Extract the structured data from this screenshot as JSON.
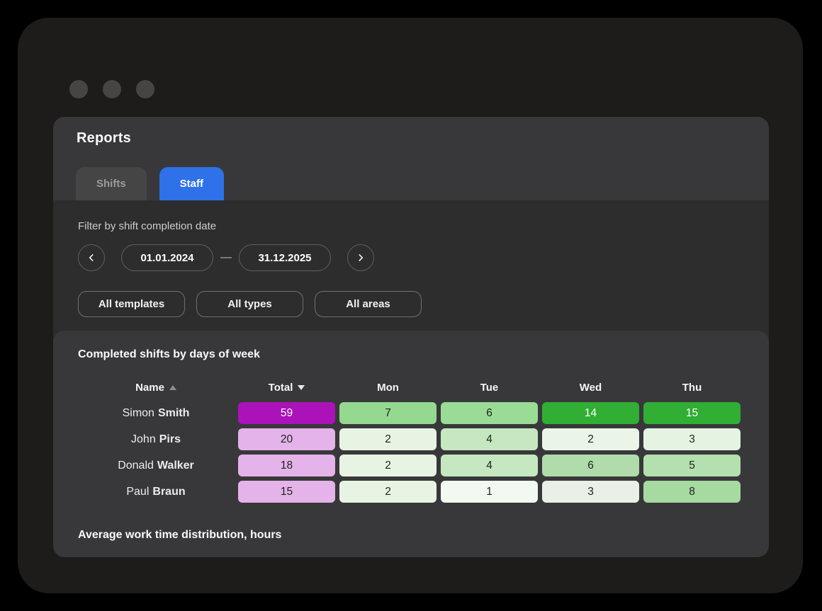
{
  "header": {
    "title": "Reports",
    "tabs": [
      {
        "label": "Shifts",
        "active": false
      },
      {
        "label": "Staff",
        "active": true
      }
    ]
  },
  "filters": {
    "label": "Filter by shift completion date",
    "date_from": "01.01.2024",
    "date_separator": "—",
    "date_to": "31.12.2025",
    "template_filter": "All templates",
    "type_filter": "All types",
    "area_filter": "All areas"
  },
  "table": {
    "title": "Completed shifts by days of week",
    "columns": [
      {
        "label": "Name",
        "sort": "asc"
      },
      {
        "label": "Total",
        "sort": "desc"
      },
      {
        "label": "Mon"
      },
      {
        "label": "Tue"
      },
      {
        "label": "Wed"
      },
      {
        "label": "Thu"
      }
    ],
    "rows": [
      {
        "first_name": "Simon",
        "last_name": "Smith",
        "cells": [
          {
            "value": "59",
            "bg": "#ab12b9",
            "fg": "#ffffff"
          },
          {
            "value": "7",
            "bg": "#95d890",
            "fg": "#1f2020"
          },
          {
            "value": "6",
            "bg": "#9adb95",
            "fg": "#1f2020"
          },
          {
            "value": "14",
            "bg": "#31ae34",
            "fg": "#ffffff"
          },
          {
            "value": "15",
            "bg": "#31ae34",
            "fg": "#ffffff"
          }
        ]
      },
      {
        "first_name": "John",
        "last_name": "Pirs",
        "cells": [
          {
            "value": "20",
            "bg": "#e4b3e9",
            "fg": "#1f2020"
          },
          {
            "value": "2",
            "bg": "#e7f4e4",
            "fg": "#1f2020"
          },
          {
            "value": "4",
            "bg": "#c5e8c1",
            "fg": "#1f2020"
          },
          {
            "value": "2",
            "bg": "#eaf5e7",
            "fg": "#1f2020"
          },
          {
            "value": "3",
            "bg": "#e5f3e2",
            "fg": "#1f2020"
          }
        ]
      },
      {
        "first_name": "Donald",
        "last_name": "Walker",
        "cells": [
          {
            "value": "18",
            "bg": "#e4b3e9",
            "fg": "#1f2020"
          },
          {
            "value": "2",
            "bg": "#e7f4e4",
            "fg": "#1f2020"
          },
          {
            "value": "4",
            "bg": "#c5e8c1",
            "fg": "#1f2020"
          },
          {
            "value": "6",
            "bg": "#afdcaa",
            "fg": "#1f2020"
          },
          {
            "value": "5",
            "bg": "#b4dfae",
            "fg": "#1f2020"
          }
        ]
      },
      {
        "first_name": "Paul",
        "last_name": "Braun",
        "cells": [
          {
            "value": "15",
            "bg": "#e4b3e9",
            "fg": "#1f2020"
          },
          {
            "value": "2",
            "bg": "#e7f4e4",
            "fg": "#1f2020"
          },
          {
            "value": "1",
            "bg": "#f2f9f1",
            "fg": "#1f2020"
          },
          {
            "value": "3",
            "bg": "#e9f0e6",
            "fg": "#1f2020"
          },
          {
            "value": "8",
            "bg": "#a7daa1",
            "fg": "#1f2020"
          }
        ]
      }
    ]
  },
  "footer": {
    "heading": "Average work time distribution, hours"
  },
  "icons": {
    "window_controls": "circle-dot",
    "prev": "chevron-left",
    "next": "chevron-right",
    "name_sort": "triangle-up",
    "total_sort": "triangle-down"
  },
  "colors": {
    "accent_blue": "#2e71e8",
    "magenta_high": "#ab12b9",
    "green_high": "#31ae34",
    "panel": "#38383a",
    "card": "#2d2d2e",
    "window": "#1d1c1b"
  }
}
